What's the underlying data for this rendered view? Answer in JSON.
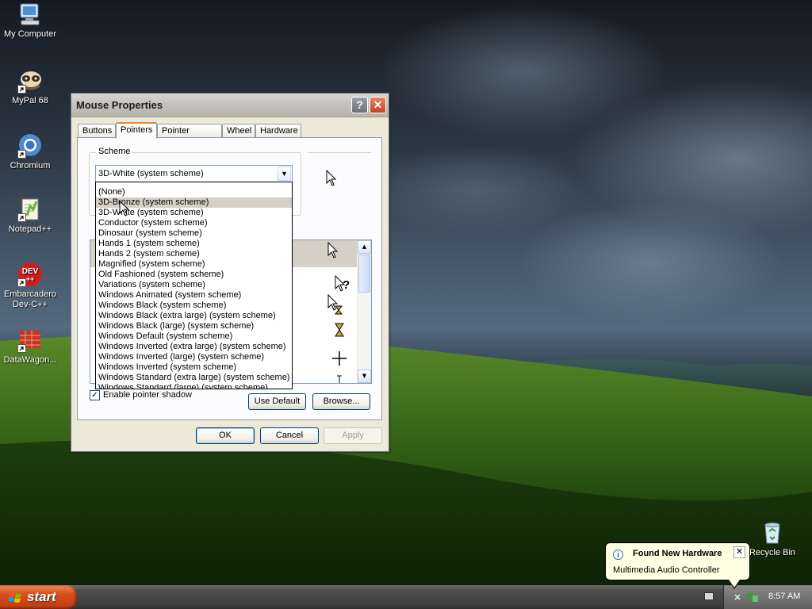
{
  "desktop": {
    "icons": [
      {
        "label": "My Computer"
      },
      {
        "label": "MyPal 68"
      },
      {
        "label": "Chromium"
      },
      {
        "label": "Notepad++"
      },
      {
        "label": "Embarcadero Dev-C++"
      },
      {
        "label": "DataWagon..."
      },
      {
        "label": "Recycle Bin"
      }
    ]
  },
  "window": {
    "title": "Mouse Properties",
    "help_label": "?",
    "close_label": "✕",
    "tabs": [
      {
        "label": "Buttons"
      },
      {
        "label": "Pointers",
        "active": true
      },
      {
        "label": "Pointer Options"
      },
      {
        "label": "Wheel"
      },
      {
        "label": "Hardware"
      }
    ],
    "scheme_label": "Scheme",
    "scheme_value": "3D-White (system scheme)",
    "scheme_options": [
      "(None)",
      "3D-Bronze (system scheme)",
      "3D-White (system scheme)",
      "Conductor (system scheme)",
      "Dinosaur (system scheme)",
      "Hands 1 (system scheme)",
      "Hands 2 (system scheme)",
      "Magnified (system scheme)",
      "Old Fashioned (system scheme)",
      "Variations (system scheme)",
      "Windows Animated (system scheme)",
      "Windows Black  (system scheme)",
      "Windows Black (extra large) (system scheme)",
      "Windows Black (large) (system scheme)",
      "Windows Default (system scheme)",
      "Windows Inverted (extra large) (system scheme)",
      "Windows Inverted (large) (system scheme)",
      "Windows Inverted (system scheme)",
      "Windows Standard (extra large) (system scheme)",
      "Windows Standard (large) (system scheme)"
    ],
    "highlighted_option": "3D-Bronze (system scheme)",
    "shadow_label": "Enable pointer shadow",
    "shadow_checked": true,
    "shadow_check_glyph": "✓",
    "use_default_label": "Use Default",
    "browse_label": "Browse...",
    "ok_label": "OK",
    "cancel_label": "Cancel",
    "apply_label": "Apply"
  },
  "balloon": {
    "title": "Found New Hardware",
    "message": "Multimedia Audio Controller",
    "info_glyph": "i",
    "close_glyph": "✕"
  },
  "taskbar": {
    "start_label": "start",
    "clock": "8:57 AM"
  },
  "colors": {
    "start_button": "#d8501f",
    "balloon_bg": "#ffffe1",
    "dialog_bg": "#ece9d8",
    "selection": "#d4d0c8"
  }
}
